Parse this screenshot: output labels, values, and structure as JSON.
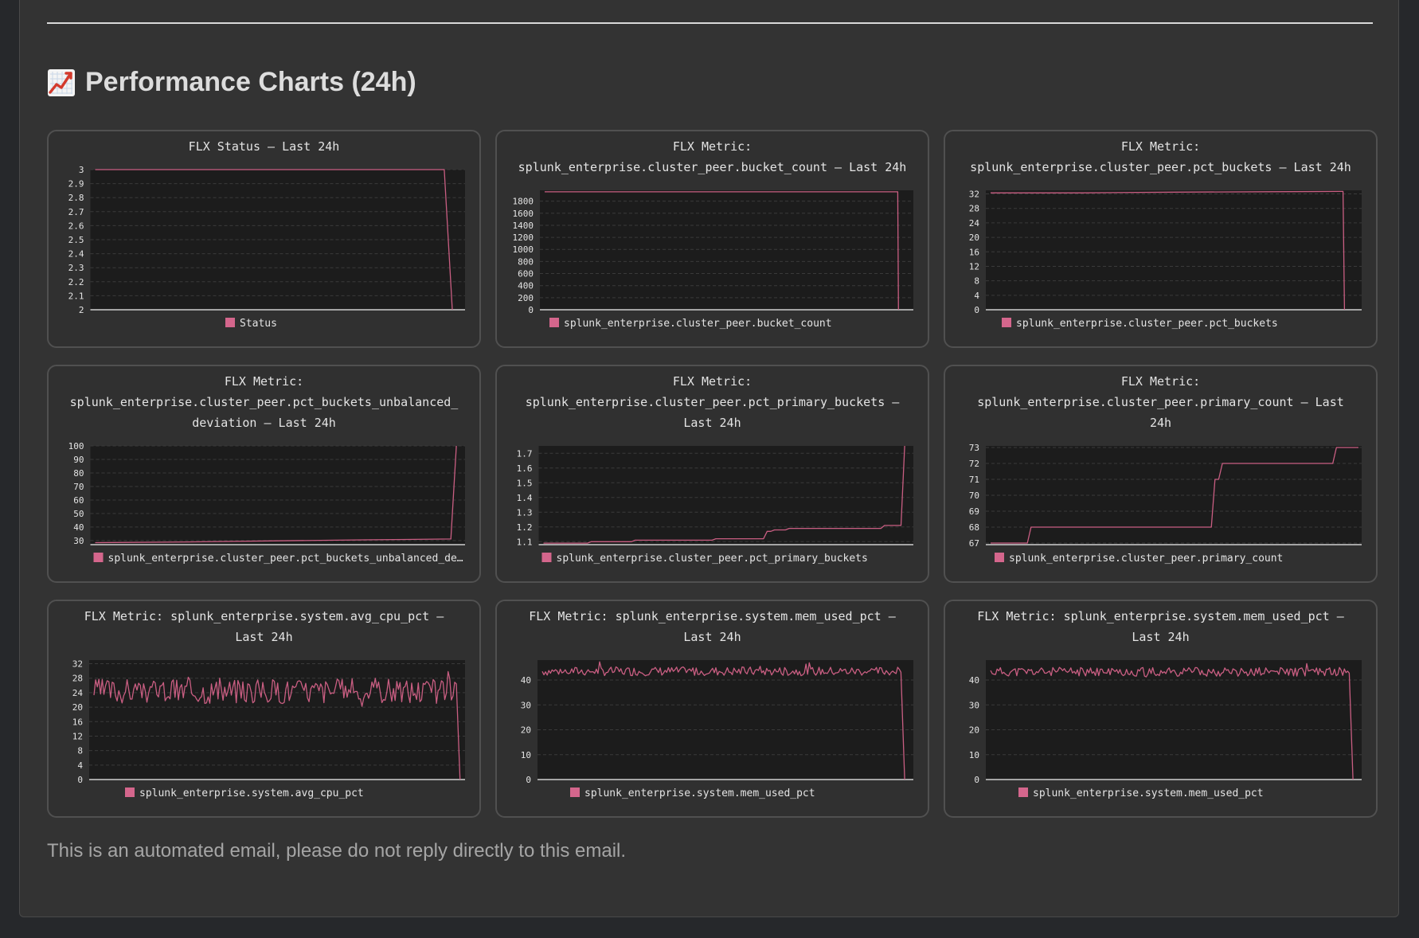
{
  "section": {
    "title": "Performance Charts (24h)",
    "icon": "chart-increasing-icon"
  },
  "footer": {
    "text": "This is an automated email, please do not reply directly to this email."
  },
  "colors": {
    "line": "#c95e82",
    "legend": "#d4668c",
    "plot_bg": "#1c1c1c",
    "text": "#e4e4e4"
  },
  "chart_data": [
    {
      "type": "line",
      "title_lines": [
        "FLX Status – Last 24h"
      ],
      "legend": "Status",
      "ylim": [
        2,
        3
      ],
      "yticks": [
        2,
        2.1,
        2.2,
        2.3,
        2.4,
        2.5,
        2.6,
        2.7,
        2.8,
        2.9,
        3
      ],
      "x": [
        0,
        0.952,
        0.974
      ],
      "y": [
        3,
        3,
        2
      ],
      "grid": true,
      "legend_position": "bottom"
    },
    {
      "type": "line",
      "title_lines": [
        "FLX Metric:",
        "splunk_enterprise.cluster_peer.bucket_count – Last 24h"
      ],
      "legend": "splunk_enterprise.cluster_peer.bucket_count",
      "ylim": [
        0,
        1980
      ],
      "yticks": [
        0,
        200,
        400,
        600,
        800,
        1000,
        1200,
        1400,
        1600,
        1800
      ],
      "x": [
        0,
        0.5,
        0.964,
        0.966,
        0.968
      ],
      "y": [
        1955,
        1955,
        1955,
        1955,
        0
      ],
      "grid": true,
      "legend_position": "bottom"
    },
    {
      "type": "line",
      "title_lines": [
        "FLX Metric:",
        "splunk_enterprise.cluster_peer.pct_buckets – Last 24h"
      ],
      "legend": "splunk_enterprise.cluster_peer.pct_buckets",
      "ylim": [
        0,
        33
      ],
      "yticks": [
        0,
        4,
        8,
        12,
        16,
        20,
        24,
        28,
        32
      ],
      "x": [
        0,
        0.25,
        0.5,
        0.75,
        0.955,
        0.958,
        0.962
      ],
      "y": [
        32.3,
        32.3,
        32.5,
        32.6,
        32.7,
        32.7,
        0
      ],
      "grid": true,
      "legend_position": "bottom"
    },
    {
      "type": "line",
      "title_lines": [
        "FLX Metric:",
        "splunk_enterprise.cluster_peer.pct_buckets_unbalanced_",
        "deviation – Last 24h"
      ],
      "legend": "splunk_enterprise.cluster_peer.pct_buckets_unbalanced_de…",
      "ylim": [
        27,
        100
      ],
      "yticks": [
        30,
        40,
        50,
        60,
        70,
        80,
        90,
        100
      ],
      "x": [
        0,
        0.25,
        0.5,
        0.75,
        0.97,
        0.985
      ],
      "y": [
        28.5,
        29,
        29.8,
        30.6,
        31.2,
        100
      ],
      "grid": true,
      "legend_position": "bottom"
    },
    {
      "type": "line",
      "title_lines": [
        "FLX Metric:",
        "splunk_enterprise.cluster_peer.pct_primary_buckets –",
        "Last 24h"
      ],
      "legend": "splunk_enterprise.cluster_peer.pct_primary_buckets",
      "ylim": [
        1.08,
        1.75
      ],
      "yticks": [
        1.1,
        1.2,
        1.3,
        1.4,
        1.5,
        1.6,
        1.7
      ],
      "x": [
        0,
        0.12,
        0.13,
        0.24,
        0.25,
        0.46,
        0.47,
        0.6,
        0.61,
        0.62,
        0.63,
        0.66,
        0.67,
        0.92,
        0.93,
        0.975,
        0.985
      ],
      "y": [
        1.09,
        1.09,
        1.1,
        1.1,
        1.11,
        1.11,
        1.12,
        1.12,
        1.17,
        1.17,
        1.18,
        1.18,
        1.19,
        1.19,
        1.21,
        1.21,
        1.75
      ],
      "grid": true,
      "legend_position": "bottom"
    },
    {
      "type": "line",
      "title_lines": [
        "FLX Metric:",
        "splunk_enterprise.cluster_peer.primary_count – Last",
        "24h"
      ],
      "legend": "splunk_enterprise.cluster_peer.primary_count",
      "ylim": [
        66.9,
        73.1
      ],
      "yticks": [
        67,
        68,
        69,
        70,
        71,
        72,
        73
      ],
      "x": [
        0,
        0.1,
        0.11,
        0.6,
        0.61,
        0.62,
        0.63,
        0.93,
        0.94,
        1.0
      ],
      "y": [
        67,
        67,
        68,
        68,
        71,
        71,
        72,
        72,
        73,
        73
      ],
      "grid": true,
      "legend_position": "bottom"
    },
    {
      "type": "line",
      "title_lines": [
        "FLX Metric: splunk_enterprise.system.avg_cpu_pct –",
        "Last 24h"
      ],
      "legend": "splunk_enterprise.system.avg_cpu_pct",
      "ylim": [
        0,
        33
      ],
      "yticks": [
        0,
        4,
        8,
        12,
        16,
        20,
        24,
        28,
        32
      ],
      "noise": {
        "n": 220,
        "base": 24.5,
        "amp": 3.5,
        "spike": 8.5,
        "seed": 3,
        "end_x": 0.995,
        "end_y": 0
      },
      "grid": true,
      "legend_position": "bottom"
    },
    {
      "type": "line",
      "title_lines": [
        "FLX Metric: splunk_enterprise.system.mem_used_pct –",
        "Last 24h"
      ],
      "legend": "splunk_enterprise.system.mem_used_pct",
      "ylim": [
        0,
        48
      ],
      "yticks": [
        0,
        10,
        20,
        30,
        40
      ],
      "noise": {
        "n": 220,
        "base": 43.5,
        "amp": 1.8,
        "spike": 4,
        "seed": 7,
        "end_x": 0.985,
        "end_y": 0
      },
      "grid": true,
      "legend_position": "bottom"
    },
    {
      "type": "line",
      "title_lines": [
        "FLX Metric: splunk_enterprise.system.mem_used_pct –",
        "Last 24h"
      ],
      "legend": "splunk_enterprise.system.mem_used_pct",
      "ylim": [
        0,
        48
      ],
      "yticks": [
        0,
        10,
        20,
        30,
        40
      ],
      "noise": {
        "n": 220,
        "base": 43.3,
        "amp": 1.8,
        "spike": 4,
        "seed": 11,
        "end_x": 0.985,
        "end_y": 0
      },
      "grid": true,
      "legend_position": "bottom"
    }
  ]
}
